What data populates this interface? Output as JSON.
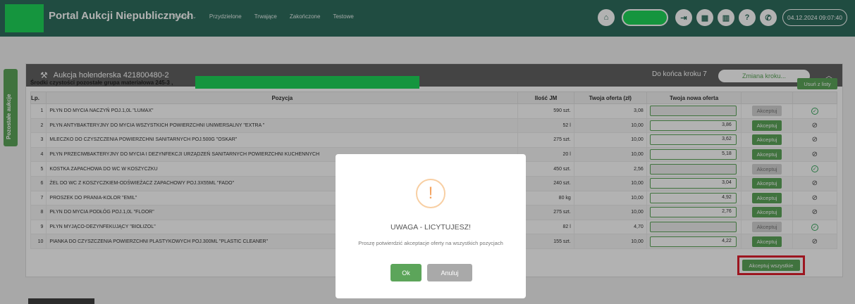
{
  "header": {
    "title": "Portal Aukcji Niepublicznych",
    "nav": [
      {
        "label": "Aukcje",
        "has_dropdown": true
      },
      {
        "label": "Przydzielone"
      },
      {
        "label": "Trwające"
      },
      {
        "label": "Zakończone"
      },
      {
        "label": "Testowe"
      }
    ],
    "icons": [
      "home-icon",
      "logout-icon",
      "calculator-icon",
      "book-icon",
      "help-icon",
      "phone-icon"
    ],
    "datetime": "04.12.2024 09:07:40"
  },
  "sidebar_tab": {
    "label": "Pozostałe aukcje"
  },
  "auction": {
    "title": "Aukcja holenderska 421800480-2",
    "deadline_label": "Do końca kroku 7",
    "change_step_label": "Zmiana kroku...",
    "group_label": "Środki czystości pozostałe grupa materiałowa 245-3 ,",
    "remove_label": "Usuń z listy",
    "columns": [
      "Lp.",
      "Pozycja",
      "Ilość JM",
      "Twoja oferta (zł)",
      "Twoja nowa oferta"
    ],
    "rows": [
      {
        "lp": "1",
        "name": "PŁYN DO MYCIA NACZYŃ POJ.1,0L \"LUMAX\"",
        "qty": "590 szt.",
        "offer": "3,08",
        "new_offer": "",
        "accept": "Akceptuj",
        "accept_enabled": false,
        "status": "ok"
      },
      {
        "lp": "2",
        "name": "PŁYN ANTYBAKTERYJNY DO MYCIA WSZYSTKICH POWIERZCHNI UNIWERSALNY \"EXTRA \"",
        "qty": "52 l",
        "offer": "10,00",
        "new_offer": "3,86",
        "accept": "Akceptuj",
        "accept_enabled": true,
        "status": "blocked"
      },
      {
        "lp": "3",
        "name": "MLECZKO DO CZYSZCZENIA POWIERZCHNI SANITARNYCH POJ.500G \"OSKAR\"",
        "qty": "275 szt.",
        "offer": "10,00",
        "new_offer": "3,62",
        "accept": "Akceptuj",
        "accept_enabled": true,
        "status": "blocked"
      },
      {
        "lp": "4",
        "name": "PŁYN PRZECIWBAKTERYJNY DO MYCIA I DEZYNFEKCJI URZĄDZEŃ SANITARNYCH POWIERZCHNI KUCHENNYCH",
        "qty": "20 l",
        "offer": "10,00",
        "new_offer": "5,18",
        "accept": "Akceptuj",
        "accept_enabled": true,
        "status": "blocked"
      },
      {
        "lp": "5",
        "name": "KOSTKA ZAPACHOWA DO WC W KOSZYCZKU",
        "qty": "450 szt.",
        "offer": "2,56",
        "new_offer": "",
        "accept": "Akceptuj",
        "accept_enabled": false,
        "status": "ok"
      },
      {
        "lp": "6",
        "name": "ŻEL DO WC Z KOSZYCZKIEM-ODŚWIEŻACZ ZAPACHOWY POJ.3X55ML \"FADO\"",
        "qty": "240 szt.",
        "offer": "10,00",
        "new_offer": "3,04",
        "accept": "Akceptuj",
        "accept_enabled": true,
        "status": "blocked"
      },
      {
        "lp": "7",
        "name": "PROSZEK DO PRANIA-KOLOR \"EMIL\"",
        "qty": "80 kg",
        "offer": "10,00",
        "new_offer": "4,92",
        "accept": "Akceptuj",
        "accept_enabled": true,
        "status": "blocked"
      },
      {
        "lp": "8",
        "name": "PŁYN DO MYCIA PODŁÓG POJ.1,0L \"FLOOR\"",
        "qty": "275 szt.",
        "offer": "10,00",
        "new_offer": "2,76",
        "accept": "Akceptuj",
        "accept_enabled": true,
        "status": "blocked"
      },
      {
        "lp": "9",
        "name": "PŁYN MYJĄCO-DEZYNFEKUJĄCY \"BIOLIZOL\"",
        "qty": "82 l",
        "offer": "4,70",
        "new_offer": "",
        "accept": "Akceptuj",
        "accept_enabled": false,
        "status": "ok"
      },
      {
        "lp": "10",
        "name": "PIANKA DO CZYSZCZENIA POWIERZCHNI PLASTYKOWYCH POJ.300ML \"PLASTIC CLEANER\"",
        "qty": "155 szt.",
        "offer": "10,00",
        "new_offer": "4,22",
        "accept": "Akceptuj",
        "accept_enabled": true,
        "status": "blocked"
      }
    ],
    "accept_all_label": "Akceptuj wszystkie"
  },
  "modal": {
    "icon": "!",
    "title": "UWAGA - LICYTUJESZ!",
    "message": "Proszę potwierdzić akceptacje oferty na wszystkich pozycjach",
    "ok_label": "Ok",
    "cancel_label": "Anuluj"
  },
  "colors": {
    "header_bg": "#2e6e5e",
    "accent_green": "#5ca55a",
    "panel_header": "#626262",
    "highlight_red": "#e0202e",
    "redaction_green": "#1fd65a"
  }
}
